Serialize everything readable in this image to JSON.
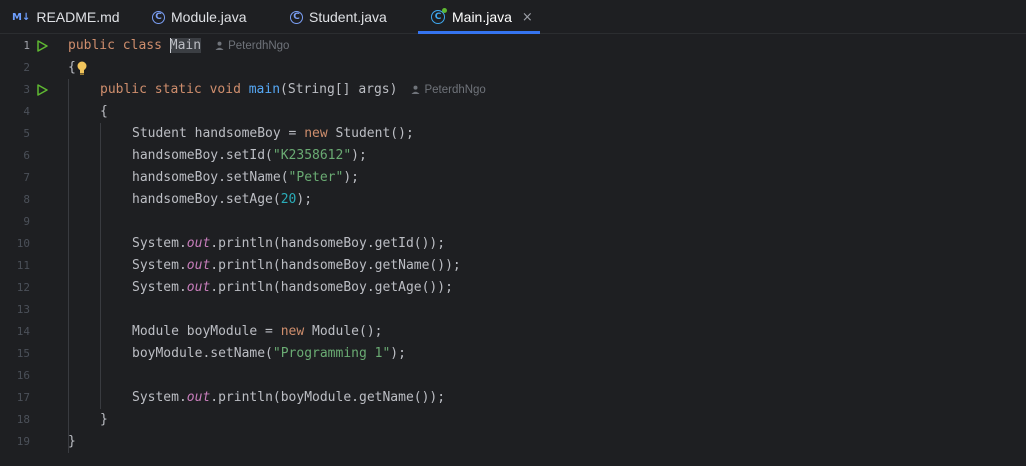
{
  "tabs": [
    {
      "icon": "markdown-icon",
      "icon_text": "M↓",
      "label": "README.md"
    },
    {
      "icon": "java-class-icon",
      "icon_text": "C",
      "label": "Module.java"
    },
    {
      "icon": "java-class-icon",
      "icon_text": "C",
      "label": "Student.java"
    },
    {
      "icon": "run-java-class-icon",
      "icon_text": "C",
      "label": "Main.java",
      "active": true,
      "close": "×"
    }
  ],
  "editor": {
    "author": "PeterdhNgo",
    "lines": [
      {
        "n": "1"
      },
      {
        "n": "2"
      },
      {
        "n": "3"
      },
      {
        "n": "4"
      },
      {
        "n": "5"
      },
      {
        "n": "6"
      },
      {
        "n": "7"
      },
      {
        "n": "8"
      },
      {
        "n": "9"
      },
      {
        "n": "10"
      },
      {
        "n": "11"
      },
      {
        "n": "12"
      },
      {
        "n": "13"
      },
      {
        "n": "14"
      },
      {
        "n": "15"
      },
      {
        "n": "16"
      },
      {
        "n": "17"
      },
      {
        "n": "18"
      },
      {
        "n": "19"
      }
    ],
    "tokens": {
      "l1_public": "public",
      "l1_class": "class",
      "l1_name": "Main",
      "l2_brace": "{",
      "l3_public": "public",
      "l3_static": "static",
      "l3_void": "void",
      "l3_main": "main",
      "l3_args": "(String[] args)",
      "l4_brace": "{",
      "l5_a": "Student handsomeBoy = ",
      "l5_new": "new",
      "l5_b": " Student();",
      "l6_a": "handsomeBoy.setId(",
      "l6_str": "\"K2358612\"",
      "l6_b": ");",
      "l7_a": "handsomeBoy.setName(",
      "l7_str": "\"Peter\"",
      "l7_b": ");",
      "l8_a": "handsomeBoy.setAge(",
      "l8_num": "20",
      "l8_b": ");",
      "sys": "System.",
      "out": "out",
      "l10_b": ".println(handsomeBoy.getId());",
      "l11_b": ".println(handsomeBoy.getName());",
      "l12_b": ".println(handsomeBoy.getAge());",
      "l14_a": "Module boyModule = ",
      "l14_new": "new",
      "l14_b": " Module();",
      "l15_a": "boyModule.setName(",
      "l15_str": "\"Programming 1\"",
      "l15_b": ");",
      "l17_b": ".println(boyModule.getName());",
      "l18_brace": "}",
      "l19_brace": "}"
    }
  },
  "colors": {
    "background": "#1e1f22",
    "keyword": "#cf8e6d",
    "function": "#56a8f5",
    "string": "#6aab73",
    "number": "#2aacb8",
    "static_field": "#c77dbb",
    "accent": "#3574f0",
    "run": "#5fb832"
  }
}
